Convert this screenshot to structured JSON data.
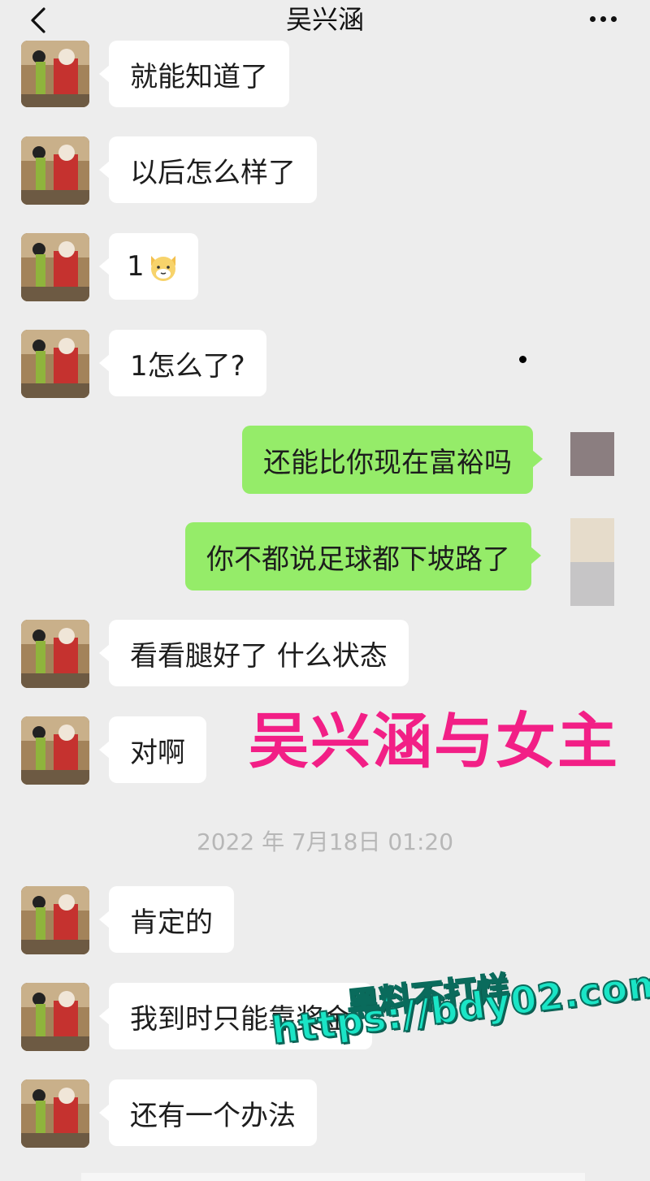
{
  "header": {
    "back_icon": "chevron-left-icon",
    "title": "吴兴涵",
    "more_icon": "more-dots-icon"
  },
  "messages": [
    {
      "side": "left",
      "text": "就能知道了"
    },
    {
      "side": "left",
      "text": "以后怎么样了"
    },
    {
      "side": "left",
      "text": "1",
      "emoji": "cat-face-icon"
    },
    {
      "side": "left",
      "text": "1怎么了?"
    },
    {
      "side": "right",
      "text": "还能比你现在富裕吗"
    },
    {
      "side": "right",
      "text": "你不都说足球都下坡路了"
    },
    {
      "side": "left",
      "text": "看看腿好了 什么状态"
    },
    {
      "side": "left",
      "text": "对啊"
    },
    {
      "side": "left",
      "text": "肯定的"
    },
    {
      "side": "left",
      "text": "我到时只能靠奖金"
    },
    {
      "side": "left",
      "text": "还有一个办法"
    }
  ],
  "timestamp": "2022 年 7月18日 01:20",
  "overlay_caption": "吴兴涵与女主",
  "watermark": {
    "line1": "黑料不打烊",
    "line2": "https://bdy02.com"
  },
  "colors": {
    "background": "#ededed",
    "incoming_bubble": "#ffffff",
    "outgoing_bubble": "#95ec69",
    "overlay_caption": "#f21f86",
    "watermark": "#1ae5c6"
  }
}
